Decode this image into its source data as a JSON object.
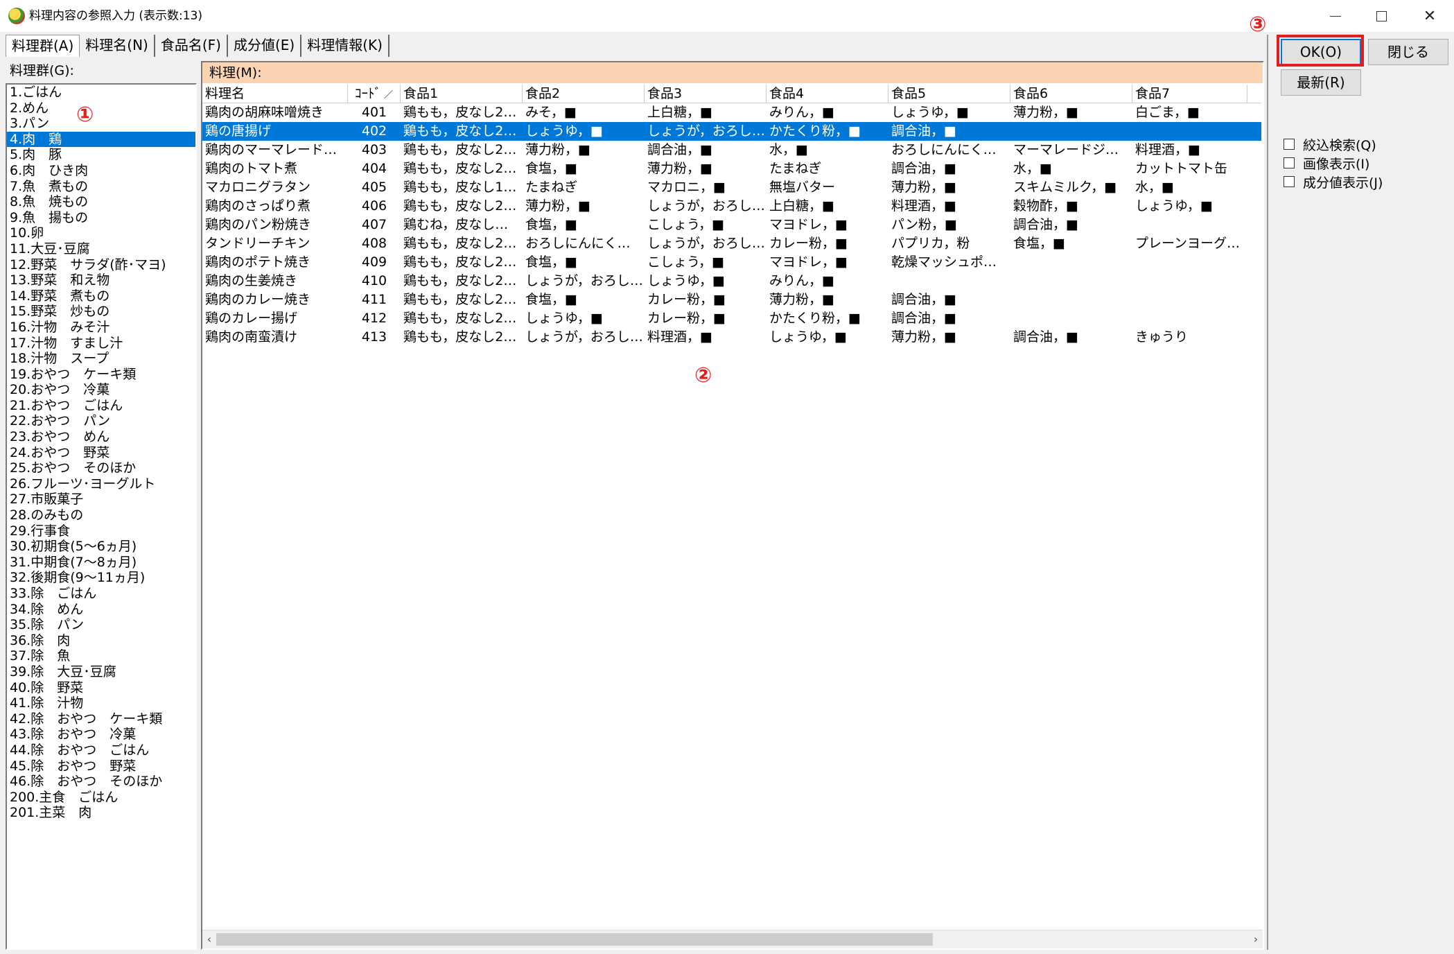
{
  "window": {
    "title": "料理内容の参照入力 (表示数:13)"
  },
  "tabs": [
    "料理群(A)",
    "料理名(N)",
    "食品名(F)",
    "成分値(E)",
    "料理情報(K)"
  ],
  "left_panel": {
    "caption": "料理群(G):",
    "items": [
      "1.ごはん",
      "2.めん",
      "3.パン",
      "4.肉　鶏",
      "5.肉　豚",
      "6.肉　ひき肉",
      "7.魚　煮もの",
      "8.魚　焼もの",
      "9.魚　揚もの",
      "10.卵",
      "11.大豆･豆腐",
      "12.野菜　サラダ(酢･マヨ)",
      "13.野菜　和え物",
      "14.野菜　煮もの",
      "15.野菜　炒もの",
      "16.汁物　みそ汁",
      "17.汁物　すまし汁",
      "18.汁物　スープ",
      "19.おやつ　ケーキ類",
      "20.おやつ　冷菓",
      "21.おやつ　ごはん",
      "22.おやつ　パン",
      "23.おやつ　めん",
      "24.おやつ　野菜",
      "25.おやつ　そのほか",
      "26.フルーツ･ヨーグルト",
      "27.市販菓子",
      "28.のみもの",
      "29.行事食",
      "30.初期食(5〜6ヵ月)",
      "31.中期食(7〜8ヵ月)",
      "32.後期食(9〜11ヵ月)",
      "33.除　ごはん",
      "34.除　めん",
      "35.除　パン",
      "36.除　肉",
      "37.除　魚",
      "39.除　大豆･豆腐",
      "40.除　野菜",
      "41.除　汁物",
      "42.除　おやつ　ケーキ類",
      "43.除　おやつ　冷菓",
      "44.除　おやつ　ごはん",
      "45.除　おやつ　野菜",
      "46.除　おやつ　そのほか",
      "200.主食　ごはん",
      "201.主菜　肉"
    ],
    "selected_index": 3
  },
  "grid": {
    "caption": "料理(M):",
    "columns": [
      "料理名",
      "ｺｰﾄﾞ",
      "食品1",
      "食品2",
      "食品3",
      "食品4",
      "食品5",
      "食品6",
      "食品7"
    ],
    "sort_indicator": "／",
    "selected_row": 1,
    "rows": [
      [
        "鶏肉の胡麻味噌焼き",
        "401",
        "鶏もも，皮なし2…",
        "みそ，■",
        "上白糖，■",
        "みりん，■",
        "しょうゆ，■",
        "薄力粉，■",
        "白ごま，■"
      ],
      [
        "鶏の唐揚げ",
        "402",
        "鶏もも，皮なし2…",
        "しょうゆ，■",
        "しょうが，おろし…",
        "かたくり粉，■",
        "調合油，■",
        "",
        ""
      ],
      [
        "鶏肉のマーマレード…",
        "403",
        "鶏もも，皮なし2…",
        "薄力粉，■",
        "調合油，■",
        "水，■",
        "おろしにんにく…",
        "マーマレードジ…",
        "料理酒，■"
      ],
      [
        "鶏肉のトマト煮",
        "404",
        "鶏もも，皮なし2…",
        "食塩，■",
        "薄力粉，■",
        "たまねぎ",
        "調合油，■",
        "水，■",
        "カットトマト缶"
      ],
      [
        "マカロニグラタン",
        "405",
        "鶏もも，皮なし1…",
        "たまねぎ",
        "マカロニ，■",
        "無塩バター",
        "薄力粉，■",
        "スキムミルク，■",
        "水，■"
      ],
      [
        "鶏肉のさっぱり煮",
        "406",
        "鶏もも，皮なし2…",
        "薄力粉，■",
        "しょうが，おろし…",
        "上白糖，■",
        "料理酒，■",
        "穀物酢，■",
        "しょうゆ，■"
      ],
      [
        "鶏肉のパン粉焼き",
        "407",
        "鶏むね，皮なし…",
        "食塩，■",
        "こしょう，■",
        "マヨドレ，■",
        "パン粉，■",
        "調合油，■",
        ""
      ],
      [
        "タンドリーチキン",
        "408",
        "鶏もも，皮なし2…",
        "おろしにんにく…",
        "しょうが，おろし…",
        "カレー粉，■",
        "パプリカ，粉",
        "食塩，■",
        "プレーンヨーグ…"
      ],
      [
        "鶏肉のポテト焼き",
        "409",
        "鶏もも，皮なし2…",
        "食塩，■",
        "こしょう，■",
        "マヨドレ，■",
        "乾燥マッシュポ…",
        "",
        ""
      ],
      [
        "鶏肉の生姜焼き",
        "410",
        "鶏もも，皮なし2…",
        "しょうが，おろし…",
        "しょうゆ，■",
        "みりん，■",
        "",
        "",
        ""
      ],
      [
        "鶏肉のカレー焼き",
        "411",
        "鶏もも，皮なし2…",
        "食塩，■",
        "カレー粉，■",
        "薄力粉，■",
        "調合油，■",
        "",
        ""
      ],
      [
        "鶏のカレー揚げ",
        "412",
        "鶏もも，皮なし2…",
        "しょうゆ，■",
        "カレー粉，■",
        "かたくり粉，■",
        "調合油，■",
        "",
        ""
      ],
      [
        "鶏肉の南蛮漬け",
        "413",
        "鶏もも，皮なし2…",
        "しょうが，おろし…",
        "料理酒，■",
        "しょうゆ，■",
        "薄力粉，■",
        "調合油，■",
        "きゅうり"
      ]
    ]
  },
  "buttons": {
    "ok": "OK(O)",
    "close": "閉じる",
    "refresh": "最新(R)"
  },
  "checkboxes": [
    "絞込検索(Q)",
    "画像表示(I)",
    "成分値表示(J)"
  ],
  "markers": [
    "①",
    "②",
    "③"
  ],
  "colors": {
    "selection": "#0078d7",
    "caption_bg": "#fbd4b4",
    "marker": "#e02020"
  }
}
